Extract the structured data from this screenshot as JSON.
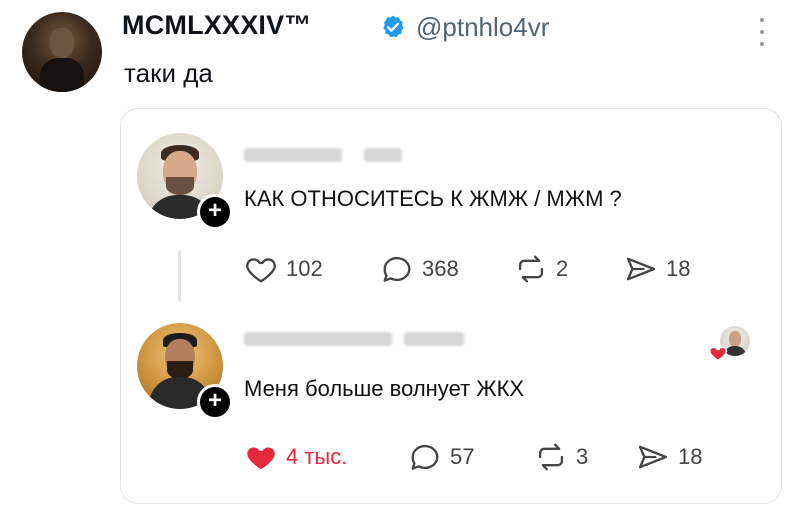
{
  "tweet": {
    "display_name": "MCMLXXXIV™",
    "handle": "@ptnhlo4vr",
    "text": "таки да",
    "verified": true
  },
  "embedded": {
    "post": {
      "text": "КАК ОТНОСИТЕСЬ К ЖМЖ / МЖМ ?",
      "actions": {
        "likes": "102",
        "replies": "368",
        "reposts": "2",
        "shares": "18"
      }
    },
    "reply": {
      "text": "Меня больше волнует ЖКХ",
      "liked_by_author": true,
      "actions": {
        "likes": "4 тыс.",
        "replies": "57",
        "reposts": "3",
        "shares": "18"
      }
    }
  },
  "icons": {
    "verified": "verified-badge-icon",
    "more": "more-vertical-icon",
    "like": "heart-icon",
    "reply": "comment-bubble-icon",
    "repost": "repost-icon",
    "share": "send-icon",
    "follow": "plus-icon"
  },
  "colors": {
    "verified": "#1d9bf0",
    "like_active": "#e5283d",
    "muted": "#536471",
    "icon": "#444444"
  }
}
